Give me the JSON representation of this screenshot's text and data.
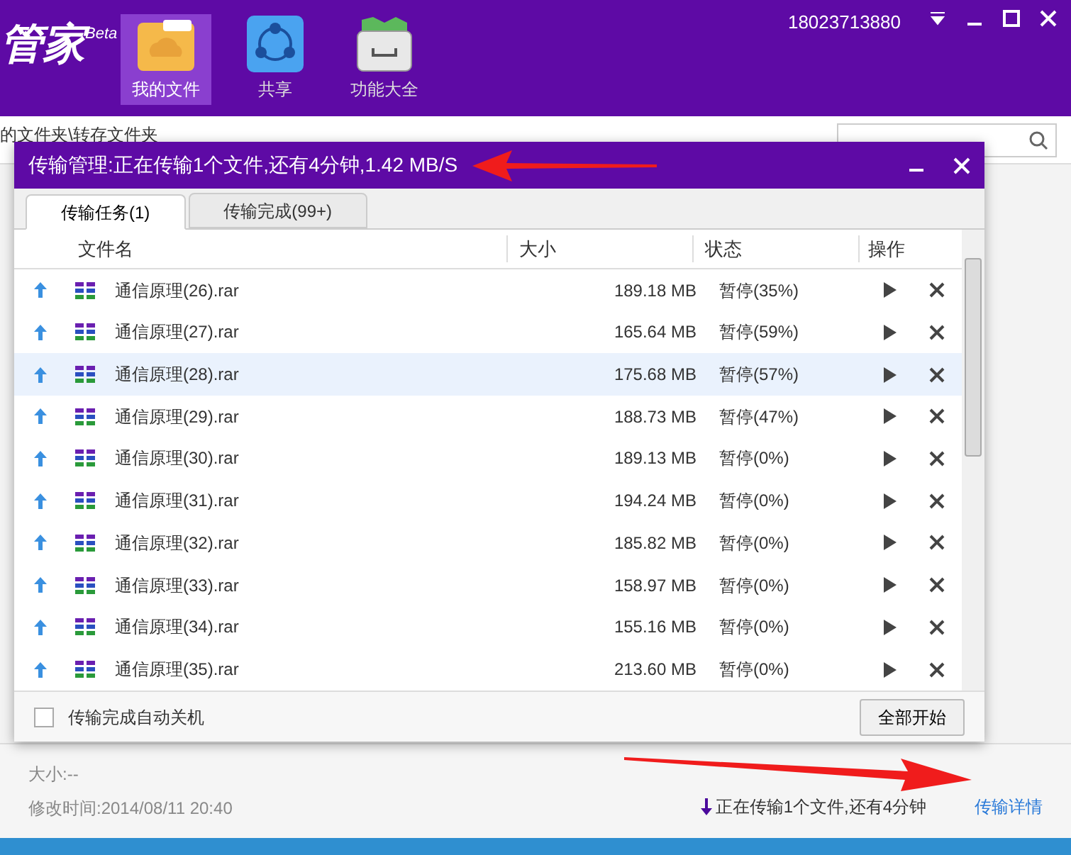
{
  "app": {
    "logo": "管家",
    "logo_badge": "Beta",
    "nav": [
      {
        "label": "我的文件",
        "selected": true,
        "kind": "folder"
      },
      {
        "label": "共享",
        "selected": false,
        "kind": "share"
      },
      {
        "label": "功能大全",
        "selected": false,
        "kind": "box"
      }
    ],
    "account": "18023713880",
    "breadcrumb": "的文件夹\\转存文件夹"
  },
  "dialog": {
    "title": "传输管理:正在传输1个文件,还有4分钟,1.42 MB/S",
    "tabs": [
      {
        "label": "传输任务(1)",
        "selected": true
      },
      {
        "label": "传输完成(99+)",
        "selected": false
      }
    ],
    "columns": [
      "文件名",
      "大小",
      "状态",
      "操作"
    ],
    "rows": [
      {
        "name": "通信原理(26).rar",
        "size": "189.18 MB",
        "status": "暂停(35%)",
        "selected": false
      },
      {
        "name": "通信原理(27).rar",
        "size": "165.64 MB",
        "status": "暂停(59%)",
        "selected": false
      },
      {
        "name": "通信原理(28).rar",
        "size": "175.68 MB",
        "status": "暂停(57%)",
        "selected": true
      },
      {
        "name": "通信原理(29).rar",
        "size": "188.73 MB",
        "status": "暂停(47%)",
        "selected": false
      },
      {
        "name": "通信原理(30).rar",
        "size": "189.13 MB",
        "status": "暂停(0%)",
        "selected": false
      },
      {
        "name": "通信原理(31).rar",
        "size": "194.24 MB",
        "status": "暂停(0%)",
        "selected": false
      },
      {
        "name": "通信原理(32).rar",
        "size": "185.82 MB",
        "status": "暂停(0%)",
        "selected": false
      },
      {
        "name": "通信原理(33).rar",
        "size": "158.97 MB",
        "status": "暂停(0%)",
        "selected": false
      },
      {
        "name": "通信原理(34).rar",
        "size": "155.16 MB",
        "status": "暂停(0%)",
        "selected": false
      },
      {
        "name": "通信原理(35).rar",
        "size": "213.60 MB",
        "status": "暂停(0%)",
        "selected": false
      }
    ],
    "auto_shutdown": {
      "label": "传输完成自动关机",
      "checked": false
    },
    "start_all": "全部开始"
  },
  "footer": {
    "size": "大小:--",
    "modified": "修改时间:2014/08/11 20:40",
    "transfer_status": "正在传输1个文件,还有4分钟",
    "details_link": "传输详情"
  }
}
